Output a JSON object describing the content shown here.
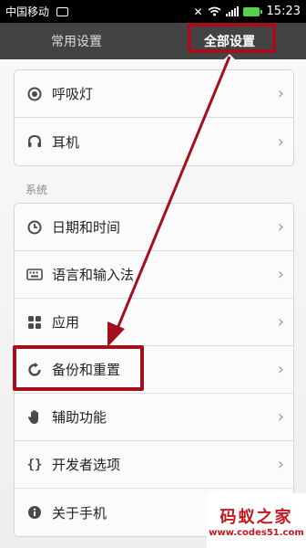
{
  "status_bar": {
    "carrier": "中国移动",
    "time": "15:23"
  },
  "tabs": {
    "common": "常用设置",
    "all": "全部设置"
  },
  "top_items": [
    {
      "label": "呼吸灯",
      "icon": "breathing-light-icon"
    },
    {
      "label": "耳机",
      "icon": "headphones-icon"
    }
  ],
  "system": {
    "title": "系统",
    "items": [
      {
        "label": "日期和时间",
        "icon": "clock-icon"
      },
      {
        "label": "语言和输入法",
        "icon": "keyboard-icon"
      },
      {
        "label": "应用",
        "icon": "apps-icon"
      },
      {
        "label": "备份和重置",
        "icon": "backup-icon"
      },
      {
        "label": "辅助功能",
        "icon": "hand-icon"
      },
      {
        "label": "开发者选项",
        "icon": "braces-icon"
      },
      {
        "label": "关于手机",
        "icon": "info-icon"
      }
    ]
  },
  "watermark": {
    "brand": "码蚁之家",
    "url": "www.codes51.com"
  },
  "colors": {
    "annotation_red": "#a3101c",
    "tab_bar": "#434343",
    "battery": "#55d14a"
  }
}
